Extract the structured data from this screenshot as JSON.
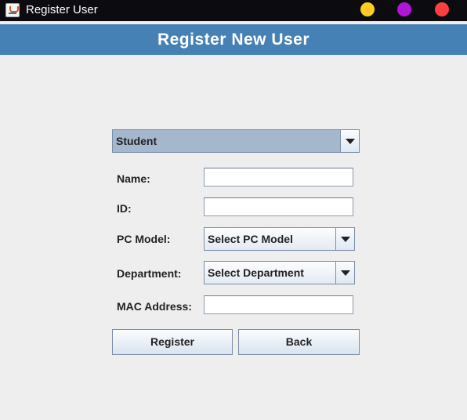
{
  "window": {
    "title": "Register User",
    "controls": {
      "minimize_color": "#ffcc1f",
      "maximize_color": "#b016d8",
      "close_color": "#ff3f3f"
    }
  },
  "header": {
    "title": "Register New User",
    "background": "#4681b5"
  },
  "form": {
    "user_type": {
      "selected": "Student"
    },
    "name": {
      "label": "Name:",
      "value": ""
    },
    "id": {
      "label": "ID:",
      "value": ""
    },
    "pc_model": {
      "label": "PC Model:",
      "selected": "Select PC Model"
    },
    "department": {
      "label": "Department:",
      "selected": "Select Department"
    },
    "mac_address": {
      "label": "MAC Address:",
      "value": ""
    }
  },
  "actions": {
    "register_label": "Register",
    "back_label": "Back"
  }
}
